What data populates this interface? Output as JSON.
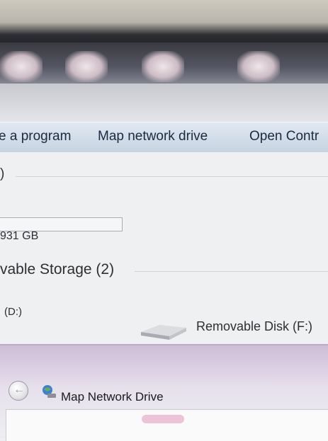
{
  "command_bar": {
    "uninstall_label": "e a program",
    "map_drive_label": "Map network drive",
    "control_panel_label": "Open Contr"
  },
  "drives": {
    "hard_disk_name_fragment": ")",
    "hard_disk_size": "931 GB",
    "removable_group_header": "vable Storage (2)",
    "drive_d_label": "(D:)",
    "drive_f_label": "Removable Disk (F:)",
    "hard_disk_used_fraction": 0
  },
  "dialog": {
    "title": "Map Network Drive"
  },
  "colors": {
    "command_bar": "#d2dde9",
    "dialog_header": "#cdbdd6",
    "text": "#2e2f33"
  }
}
